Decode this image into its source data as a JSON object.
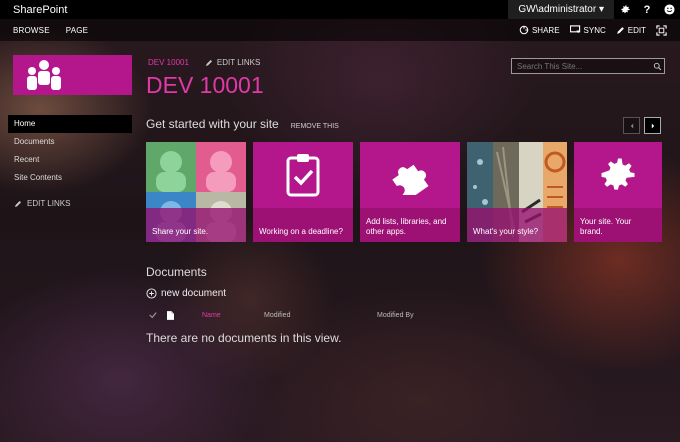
{
  "topbar": {
    "brand": "SharePoint",
    "user": "GW\\administrator ▾",
    "icons": [
      "gear-icon",
      "help-icon",
      "smiley-icon"
    ]
  },
  "ribbon": {
    "tabs": [
      "BROWSE",
      "PAGE"
    ],
    "actions": [
      {
        "label": "SHARE",
        "icon": "share-icon"
      },
      {
        "label": "SYNC",
        "icon": "sync-icon"
      },
      {
        "label": "EDIT",
        "icon": "pencil-icon"
      }
    ],
    "focus_icon": "focus-mode-icon"
  },
  "site": {
    "breadcrumb": "DEV 10001",
    "edit_links": "EDIT LINKS",
    "title": "DEV 10001",
    "logo_icon": "people-icon"
  },
  "search": {
    "placeholder": "Search This Site..."
  },
  "nav": {
    "items": [
      "Home",
      "Documents",
      "Recent",
      "Site Contents"
    ],
    "edit_links": "EDIT LINKS"
  },
  "getstarted": {
    "title": "Get started with your site",
    "remove": "REMOVE THIS",
    "tiles": [
      {
        "caption": "Share your site.",
        "icon": "people-photos-icon"
      },
      {
        "caption": "Working on a deadline?",
        "icon": "clipboard-check-icon"
      },
      {
        "caption": "Add lists, libraries, and other apps.",
        "icon": "puzzle-icon"
      },
      {
        "caption": "What's your style?",
        "icon": "style-photos-icon"
      },
      {
        "caption": "Your site. Your brand.",
        "icon": "gear-icon"
      }
    ]
  },
  "documents": {
    "title": "Documents",
    "new_doc": "new document",
    "columns": {
      "name": "Name",
      "modified": "Modified",
      "modified_by": "Modified By"
    },
    "empty": "There are no documents in this view."
  },
  "colors": {
    "accent": "#b4168b",
    "accent_text": "#e03aa8",
    "topbar": "#000000"
  }
}
